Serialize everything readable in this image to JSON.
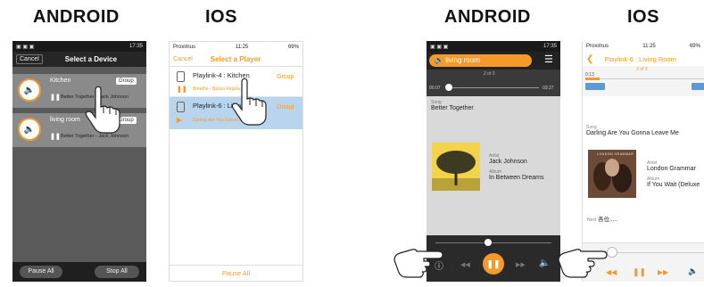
{
  "headers": {
    "a1": "ANDROID",
    "i1": "IOS",
    "a2": "ANDROID",
    "i2": "IOS"
  },
  "s1": {
    "time": "17:35",
    "cancel": "Cancel",
    "title": "Select a Device",
    "devices": [
      {
        "name": "Kitchen",
        "group": "Group",
        "track": "Better Together - Jack Johnson"
      },
      {
        "name": "living room",
        "group": "Group",
        "track": "Better Together - Jack Johnson"
      }
    ],
    "pause_all": "Pause All",
    "stop_all": "Stop All"
  },
  "s2": {
    "carrier": "Proximus",
    "time": "11:25",
    "battery": "69%",
    "cancel": "Cancel",
    "title": "Select a Player",
    "players": [
      {
        "name": "Playlink-4 : Kitchen",
        "group": "Group",
        "track": "Breathe - Bassa Regola..."
      },
      {
        "name": "Playlink-6 : Living R",
        "group": "Group",
        "track": "Darling Are You Gonna Leave..."
      }
    ],
    "pause_all": "Pause All"
  },
  "s3": {
    "time": "17:35",
    "room": "living room",
    "counter": "2 of 3",
    "elapsed": "00:07",
    "total": "03:27",
    "song_label": "Song",
    "song": "Better Together",
    "artist_label": "Artist",
    "artist": "Jack Johnson",
    "album_label": "Album",
    "album": "In Between Dreams"
  },
  "s4": {
    "carrier": "Proximus",
    "time": "11:25",
    "battery": "69%",
    "title": "Playlink-6 : Living Room",
    "counter": "3 of 3",
    "elapsed": "0:13",
    "song_label": "Song",
    "song": "Darling Are You Gonna Leave Me",
    "art_text": "LONDON GRAMMAR",
    "artist_label": "Artist",
    "artist": "London Grammar",
    "album_label": "Album",
    "album": "If You Wait (Deluxe",
    "next_label": "Next",
    "next": "各位....."
  },
  "colors": {
    "orange": "#f39a2b",
    "dark": "#2c2c2c",
    "gray": "#5a5a5a",
    "bluehl": "#b9d5ee"
  },
  "progress": {
    "s3": 0.03,
    "s4": 0.12,
    "s3_volume": 0.45,
    "s4_volume": 0.22
  }
}
